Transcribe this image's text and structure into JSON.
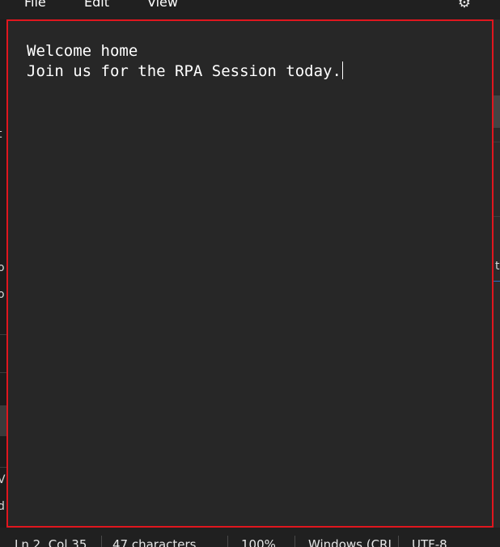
{
  "menu": {
    "file": "File",
    "edit": "Edit",
    "view": "View"
  },
  "icons": {
    "settings": "gear-icon"
  },
  "editor": {
    "lines": [
      "Welcome home",
      "Join us for the RPA Session today."
    ],
    "frame_color": "#e0161e"
  },
  "status": {
    "position": "Ln 2, Col 35",
    "characters": "47 characters",
    "zoom": "100%",
    "line_ending": "Windows (CRLF)",
    "encoding": "UTF-8"
  },
  "background": {
    "fragments": [
      "t",
      "o",
      "o",
      "V",
      "d",
      "'F",
      "t"
    ]
  }
}
